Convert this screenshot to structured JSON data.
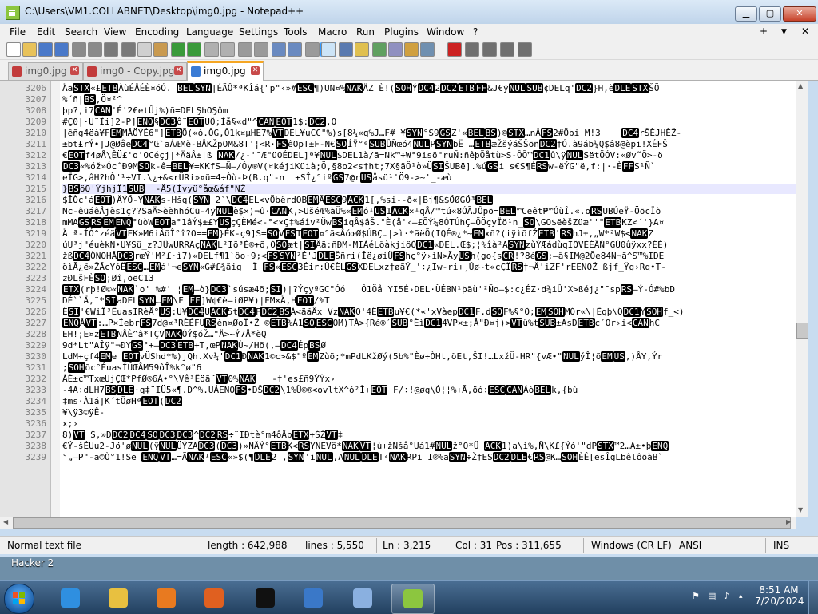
{
  "window": {
    "title": "C:\\Users\\VM1.COLLABNET\\Desktop\\img0.jpg - Notepad++",
    "min_glyph": "▁",
    "max_glyph": "▢",
    "close_glyph": "✕"
  },
  "menubar": {
    "items": [
      "File",
      "Edit",
      "Search",
      "View",
      "Encoding",
      "Language",
      "Settings",
      "Tools",
      "Macro",
      "Run",
      "Plugins",
      "Window",
      "?"
    ],
    "right_plus": "+",
    "right_arrow": "▼",
    "right_close": "✕"
  },
  "toolbar": {
    "buttons": [
      {
        "icon": "new-file-icon",
        "color": "#ffffff"
      },
      {
        "icon": "open-file-icon",
        "color": "#e8c25a"
      },
      {
        "icon": "save-icon",
        "color": "#4a79c9"
      },
      {
        "icon": "save-all-icon",
        "color": "#4a79c9"
      },
      {
        "icon": "close-file-icon",
        "color": "#8a8a8a"
      },
      {
        "icon": "close-all-icon",
        "color": "#8a8a8a"
      },
      {
        "icon": "print-icon",
        "color": "#7a7a7a"
      },
      {
        "icon": "cut-icon",
        "color": "#7a7a7a"
      },
      {
        "icon": "copy-icon",
        "color": "#d0d0d0"
      },
      {
        "icon": "paste-icon",
        "color": "#c99a50"
      },
      {
        "icon": "undo-icon",
        "color": "#3a9a3a"
      },
      {
        "icon": "redo-icon",
        "color": "#3a9a3a"
      },
      {
        "icon": "find-icon",
        "color": "#b0b0b0"
      },
      {
        "icon": "replace-icon",
        "color": "#b0b0b0"
      },
      {
        "icon": "zoom-in-icon",
        "color": "#9a9a9a"
      },
      {
        "icon": "zoom-out-icon",
        "color": "#9a9a9a"
      },
      {
        "icon": "sync-v-icon",
        "color": "#6a8ac0"
      },
      {
        "icon": "sync-h-icon",
        "color": "#6a8ac0"
      },
      {
        "icon": "word-wrap-icon",
        "color": "#9a9a9a"
      },
      {
        "icon": "show-all-chars-icon",
        "color": "#5a7ab0"
      },
      {
        "icon": "indent-guide-icon",
        "color": "#5a7ab0"
      },
      {
        "icon": "udl-icon",
        "color": "#e0c050"
      },
      {
        "icon": "doc-map-icon",
        "color": "#60a060"
      },
      {
        "icon": "function-list-icon",
        "color": "#9090c0"
      },
      {
        "icon": "folder-workspace-icon",
        "color": "#d0a040"
      },
      {
        "icon": "monitor-icon",
        "color": "#7090b0"
      },
      {
        "icon": "record-macro-icon",
        "color": "#cc2222"
      },
      {
        "icon": "stop-record-icon",
        "color": "#707070"
      },
      {
        "icon": "play-macro-icon",
        "color": "#707070"
      },
      {
        "icon": "play-multiple-icon",
        "color": "#707070"
      },
      {
        "icon": "save-macro-icon",
        "color": "#707070"
      }
    ],
    "active_index": 19
  },
  "tabs": [
    {
      "label": "img0.jpg",
      "active": false
    },
    {
      "label": "img0 - Copy.jpg",
      "active": false
    },
    {
      "label": "img0.jpg",
      "active": true
    }
  ],
  "editor": {
    "lines": [
      {
        "n": "3206",
        "text": "ÄäSTX«£ETBÀùÉÂÉÈ¤óÓ. BELSYN|ÉÃÔ*ªKÎá{\"p\"‹»#ESC¶)UN¤%NAKÄZ¯È!(SOHÝDC42DC2ETBFF&J€ÿNULSUB¢DELq'DC2}H,èDLESTXŠÕ"
      },
      {
        "n": "3207",
        "text": "%´ñ|BS,Ö¤²^"
      },
      {
        "n": "3208",
        "text": "þp?,i7CAN'É'2€etÛj%)ñ=DELŞhOŞôm"
      },
      {
        "n": "3209",
        "text": "#Ç0|·U¨Îi]2-P]ENQ§DC3ô¨EOTÜÔ;Ìå§«d\"^CANEOT1$:DC2,Ö"
      },
      {
        "n": "3210",
        "text": "|êñg4ëà¥FEMMÂÖÝÉ6\"]ETBÕ(«ò.ÔG,Ô1k¤µHE7%VTDEL¥uCC\"%)s[8¼«q%J…F# ¥SYN°S9GSZ'«BELBS)©STX…nÂFS2#Õbi M!3    DC4rŠÈJHÈŽ-"
      },
      {
        "n": "3211",
        "text": "±bt£rÝ•]J@ØåeDC4°Œ`aÁÆMè-BÂKŽpOM&8T'¦<R·FSêOpT±F-N€SOÍŸ°ªSUBÛÑœó4NULPSYNbË¨…ETBæŽšýáŠŠöñDC2†Ó.à9áb¼Q$â8@èpi!XÉFŠ"
      },
      {
        "n": "3212",
        "text": "€EOTf4øÅ\\ÊÜ£'o'OCéçj|*ÄäÂ±|ß NAK/¿-'¯Æ\"üOÉDEL]ª¥NUL$DEL1à/ã=Nk™÷W°9isõ\"ruÑ:ñêþÕåtù>S-ÔÕ™DC1û\\ÿNULSëtÕÓV:«Øv˜Õ>-ö"
      },
      {
        "n": "3213",
        "text": "DC3«%óž»ÓcˆÐ9MSOk-ê=BEL¥=KKfS–Ñ–/Óy®V(¤kéjiKüià;Ö,§8o2<s†ht;7X§ãÖ¹ò»ÜSIŠUBë].%úGSi s€S¶ÉRSw-ëÝG\"ë,f:|·-ÈFFS¹Ñ`"
      },
      {
        "n": "3214",
        "text": "eÏG>,âH?hÒ\"¹÷VI.\\¿+&<rÜRi»¤ü=4÷Òù-Þ(B.q\"-n  +SÎ¿°iºGS7@rUSåsü¹'Ö9->~'_-æù"
      },
      {
        "n": "3215",
        "text": "}BSöQ'ÝjhjÏ1SUB  -Å5(Ìvyü°åœ&áf\"NŽ"
      },
      {
        "n": "3216",
        "text": "$ÎÒc'áEOT)ÄÝÖ-ÝNAKs-Hšq(SYN 2`\\DC4EL<vÕbêrdOBEMÃESC9ACK1[,%si--ð«|Bj¶&$ÖØGÖ³BEL"
      },
      {
        "n": "3217",
        "text": "Nc-êüáêÅjès1ç??SäÄ>èèhhóCü-4ÿNULè$×)¬û·CANK,>UšéÆ%àÜ%«EMó¹US1ACK×¹qÅ/™tú«8ÓÃJÔpõ=BEL™Ceêt₱™ÓùÎ.«.oRSUBÚeŸ-ÖöcÏò"
      },
      {
        "n": "3218",
        "text": "mMAGSRSEMENQ°üòWEOTa°1âÝ$±£YUSçÇÈMé<-°<×Ç‡%áîv²ÜwBSiqÂ$âŠ.°È(å'‹—£ÕÝ¼8ÓTÚhÇ—ÕÖçyÏö¹n_SO\\GO$ëèšZüæ''\"ETBKZ<´'}A¤"
      },
      {
        "n": "3219",
        "text": "Ä ª-ÍÓ^zéäVTFK»M6iÂõÎ°î?O==EM}ÉK-ç9]S=SOVFSTEOT¤°ã<ÂóœØ$ÚBÇ…|>ì·*ãëÕ(IQÉ®¿*~EMxñ?(iÿìõfŽETB'RShJ±,„W*²W$<NAKZ"
      },
      {
        "n": "3220",
        "text": "úÜ³j\"éuèkN•U¥Sü_z?JÛwÜRRÃçNAKL²Iõ³È®+õ,ÒSOæt|SIÂã:ñÐM-MIÀéLöàkjiöÒDC1«DEL.Œ$;¦%îà²ASYNzùÝÆádùqIÕVÉÉÄÑ°GÙ0ûÿxx?ÉÉ)"
      },
      {
        "n": "3221",
        "text": "žßDC4ÒNOHÅDC3rœÝ'M²£·ì7)«DELf¶1`ôo·9;<FSSYN²É'JDLEŠñri(Îë¿øiÜFShç°ÿ›ìN>ÃyUSh(go{sCR!?8éGS;—ä§IM@2Õe84N¬ã^S™%IDE"
      },
      {
        "n": "3222",
        "text": "öìÃ¿ë»ŽÃcYóËESC…EMá'¬eSYN«G#£¾ãig  Ï FS«ESC3Éir:Ù€ÈLGSXDELxz†øãÝ_'÷¿Iw-ri+¸Ûø~t«cÇÏRS†¬Ä'iZF'rEENOŽ ßjf_Ÿg›Rq•T-"
      },
      {
        "n": "3223",
        "text": "zÐLšFÈSO;Øî,õëC13"
      },
      {
        "n": "3224",
        "text": "ETX(rþ!Ø©«NAK`o' %#' ¦EM—ò}DC3`súsæ4õ;SI)|?ÝçyªGC\"Óó   Ô1Öå YI5É›DEL·ÜÉBN¹þäù'²Ño—$:¢¿ÉZ·d¾iÛ'X>ßéj¿\"¯spRS—Ý-Ó#%bD"
      },
      {
        "n": "3225",
        "text": "DÉ``Ä,¨*SIaDELSYN…EM\\F FF]W¢€è—iØP¥)|FM×Ä,HEOT/%T"
      },
      {
        "n": "3226",
        "text": "ÊSI'€WiÏ³ÊuasIRèÅ°US:Ü¥DC4UACK5tDC4FDC2BSÀ<ääÄx VzNAKO'4ÊETBu¥€(*«'xVàepDC1F.dSOF%§°Õ;EMSOHMÓr«\\|Êqþ\\ÔDC1YSOHf_<)"
      },
      {
        "n": "3227",
        "text": "ENQÂVT:…P×ÍebrFS7d@¤³RÈÉFURSèn¤ØoÏ•Ž ©ETB%Á1SOESCOM)TÀ>{Ré®´SUB°ÈìDC14VP×±;Â\"Ð¤j)>VTû%tSUB±AsDETBc´Or›i<CANhC"
      },
      {
        "n": "3228",
        "text": "EH!;E¤zETBNÂÈ^â*TÇVNAKÓÝ$óŽ…\"Ä>~Ý7Å*èQ"
      },
      {
        "n": "3229",
        "text": "9d*Lt\"AÎÿ\"¬ÐYGS°+—DC3ETB+T,œPNAKÙ~/Hõ(,—DC4ÉpBSØ"
      },
      {
        "n": "3230",
        "text": "LdM+çf4EMe EOTvÜShd*%)jQh.Xv¼'DC1ÐNAK1©c>&$\"ºEMZùö;*mPdLKžØý(5b%\"Èø÷ÒHt,öEt,ŠI!…LxžÜ-HR\"{vÆ•\"NULýÎ¦õEMUS,)ÂY,Ýr"
      },
      {
        "n": "3231",
        "text": ";SOHõc°ÉuasÍÜŒÂM59ôÎ%k°ø\"6"
      },
      {
        "n": "3232",
        "text": "ÁÉ±c™TxœÜjÇŒ*PfØ®6Á•°\\Vê³Êöã¨VT0%NAK   -†'es£ñ9ÝÝx›"
      },
      {
        "n": "3233",
        "text": "-4A÷dLH7BSDLE·q‡¨IÜ5«¶.D^%.UÁENOFS•DŠDC2\\1%Ü©®<ovltX^ó²Ì+EOT F/÷!@øg\\Ó¦¦%+Ã,öó÷ESCCANÁòBELk,{bù"
      },
      {
        "n": "3234",
        "text": "‡ms·À1á]K´tÕøHªEOT(DC2"
      },
      {
        "n": "3235",
        "text": "¥\\ÿ3©ÿÊ-"
      },
      {
        "n": "3236",
        "text": "x;›"
      },
      {
        "n": "3237",
        "text": "8)VT Š,»DDC2DC4SODC3DC3^DC2RS÷¨IÐtè°m4ôÅbETX+ŠŽVT‡"
      },
      {
        "n": "3238",
        "text": "€Ý-šÉUu2-Jö'øNUL(ÿNULÜÝZADC3(DC3)»NÄÝ°ETBK<RSYNEVö*NAKVT¦ù+žNšå°Uá1#NULž°O*Ü ACK1)a\\ì%,Ñ\\K£{Ýó'\"dPSTX™2…A±•þENQ"
      },
      {
        "n": "3239",
        "text": "°„—P\"-a©Ò°1!Se ENQVT…=ÃNAK¹ESC«»$(¶DLE2 ,SYN'iNUL,ANULDLET²NAKRPi¯I®%aSYN÷Ž†ESDC2DLE€RS@K…SOHÈÊ[esÎgLbêlôöàB`"
      }
    ]
  },
  "statusbar": {
    "filetype": "Normal text file",
    "length": "length : 642,988",
    "lines": "lines : 5,550",
    "ln": "Ln : 3,215",
    "col": "Col : 31",
    "pos": "Pos : 311,655",
    "eol": "Windows (CR LF)",
    "encoding": "ANSI",
    "mode": "INS"
  },
  "desktop": {
    "label": "Hacker 2"
  },
  "taskbar": {
    "apps": [
      {
        "name": "internet-explorer-icon",
        "color": "#2f8fe0",
        "running": false
      },
      {
        "name": "windows-explorer-icon",
        "color": "#e8c040",
        "running": false
      },
      {
        "name": "media-player-icon",
        "color": "#e87a20",
        "running": false
      },
      {
        "name": "firefox-icon",
        "color": "#e06020",
        "running": false
      },
      {
        "name": "command-prompt-icon",
        "color": "#111111",
        "running": false
      },
      {
        "name": "remote-desktop-icon",
        "color": "#3a78c8",
        "running": false
      },
      {
        "name": "paint-icon",
        "color": "#8ab0e0",
        "running": false
      },
      {
        "name": "notepadpp-icon",
        "color": "#8cc63f",
        "running": true
      }
    ],
    "time": "8:51 AM",
    "date": "7/20/2024"
  }
}
